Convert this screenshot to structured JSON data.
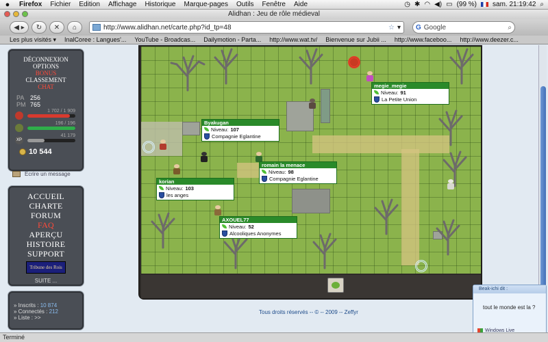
{
  "os_menubar": {
    "app": "Firefox",
    "items": [
      "Fichier",
      "Edition",
      "Affichage",
      "Historique",
      "Marque-pages",
      "Outils",
      "Fenêtre",
      "Aide"
    ],
    "battery": "(99 %)",
    "clock": "sam. 21:19:42"
  },
  "window": {
    "title": "Alidhan : Jeu de rôle médieval"
  },
  "toolbar": {
    "url": "http://www.alidhan.net/carte.php?id_tp=48",
    "search_placeholder": "Google"
  },
  "bookmarks": [
    "Les plus visités ▾",
    "InalCoree : Langues'...",
    "YouTube - Broadcas...",
    "Dailymotion - Parta...",
    "http://www.wat.tv/",
    "Bienvenue sur Jubii ...",
    "http://www.faceboo...",
    "http://www.deezer.c..."
  ],
  "stat_panel": {
    "links": [
      "DÉCONNEXION",
      "OPTIONS",
      "BONUS",
      "CLASSEMENT",
      "CHAT"
    ],
    "pa_label": "PA",
    "pa_value": "256",
    "pm_label": "PM",
    "pm_value": "765",
    "hp_text": "1 702 / 1 909",
    "mana_text": "196 / 196",
    "xp_label": "XP",
    "xp_text": "41 179",
    "hp_fraction": 0.89,
    "mana_fraction": 1.0,
    "xp_fraction": 0.35,
    "gold": "10 544"
  },
  "message_link": "Ecrire un message",
  "main_menu": {
    "items": [
      "ACCUEIL",
      "CHARTE",
      "FORUM",
      "FAQ",
      "APERÇU",
      "HISTOIRE",
      "SUPPORT"
    ],
    "banner": "Tribune des Rois",
    "suite": "SUITE ..."
  },
  "online": {
    "inscrits_label": "Inscrits :",
    "inscrits_value": "10 874",
    "connectes_label": "Connectés :",
    "connectes_value": "212",
    "liste_label": "Liste :",
    "liste_value": ">>"
  },
  "players": [
    {
      "name": "megie_megie",
      "level_label": "Niveau:",
      "level": "91",
      "guild": "La Petite Union"
    },
    {
      "name": "Byakugan",
      "level_label": "Niveau:",
      "level": "107",
      "guild": "Compagnie Eglantine"
    },
    {
      "name": "romain la menace",
      "level_label": "Niveau:",
      "level": "98",
      "guild": "Compagnie Eglantine"
    },
    {
      "name": "korian",
      "level_label": "Niveau:",
      "level": "103",
      "guild": "les anges"
    },
    {
      "name": "AXOUEL77",
      "level_label": "Niveau:",
      "level": "52",
      "guild": "Alcooliques Anonymes"
    }
  ],
  "copyright": "Tous droits réservés -- © -- 2009 -- Zeffyr",
  "chat_popup": {
    "header": "Beak-ichi dit :",
    "message": "tout le monde est la ?",
    "brand": "Windows Live"
  },
  "status_bar": "Terminé",
  "colors": {
    "map_grass": "#8bb34c",
    "panel_bg": "#4a4e55",
    "guild_green": "#2a8a2a",
    "accent_red": "#ff4a3a"
  }
}
